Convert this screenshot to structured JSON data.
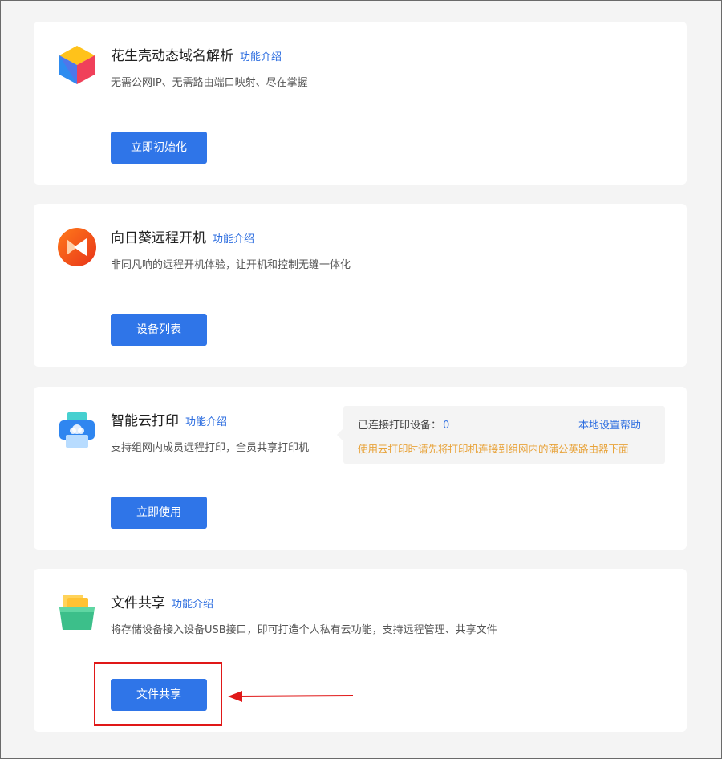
{
  "cards": [
    {
      "title": "花生壳动态域名解析",
      "intro_link": "功能介绍",
      "description": "无需公网IP、无需路由端口映射、尽在掌握",
      "button": "立即初始化",
      "icon": "cube-icon"
    },
    {
      "title": "向日葵远程开机",
      "intro_link": "功能介绍",
      "description": "非同凡响的远程开机体验，让开机和控制无缝一体化",
      "button": "设备列表",
      "icon": "sunflower-icon"
    },
    {
      "title": "智能云打印",
      "intro_link": "功能介绍",
      "description": "支持组网内成员远程打印，全员共享打印机",
      "button": "立即使用",
      "icon": "printer-icon",
      "info": {
        "connected_label": "已连接打印设备：",
        "connected_count": "0",
        "help_link": "本地设置帮助",
        "warning": "使用云打印时请先将打印机连接到组网内的蒲公英路由器下面"
      }
    },
    {
      "title": "文件共享",
      "intro_link": "功能介绍",
      "description": "将存储设备接入设备USB接口，即可打造个人私有云功能，支持远程管理、共享文件",
      "button": "文件共享",
      "icon": "folder-icon"
    }
  ],
  "colors": {
    "accent": "#2f75e8",
    "link": "#2f6fe0",
    "warning": "#e8a33a",
    "annotation": "#e01818"
  }
}
